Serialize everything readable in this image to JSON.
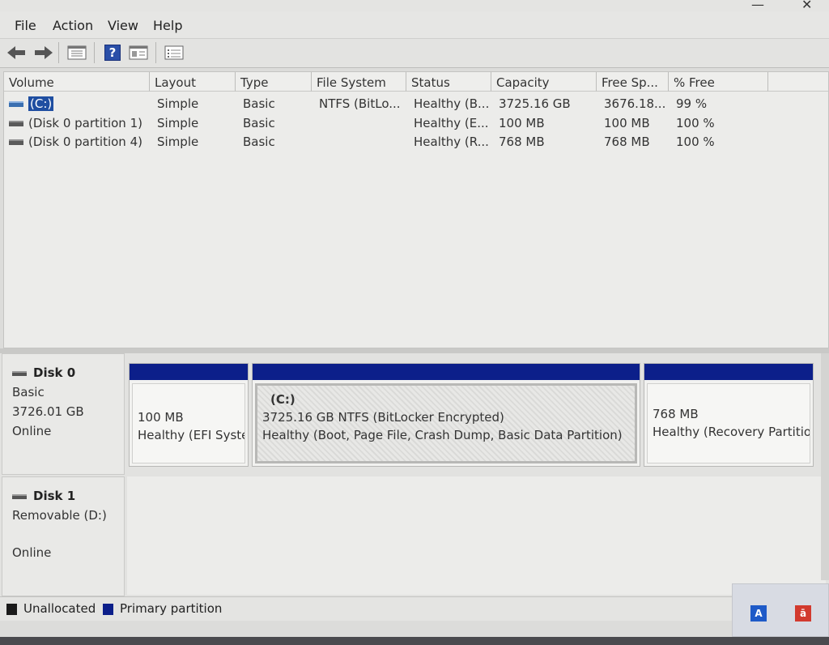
{
  "window": {
    "minimize_glyph": "—",
    "close_glyph": "✕"
  },
  "menu": {
    "items": [
      "File",
      "Action",
      "View",
      "Help"
    ]
  },
  "toolbar": {
    "buttons": [
      "back-icon",
      "forward-icon",
      "properties-grid-icon",
      "help-icon",
      "show-hide-pane-icon",
      "settings-list-icon"
    ],
    "help_glyph": "?"
  },
  "volume_table": {
    "columns": [
      "Volume",
      "Layout",
      "Type",
      "File System",
      "Status",
      "Capacity",
      "Free Sp...",
      "% Free"
    ],
    "rows": [
      {
        "volume": "(C:)",
        "layout": "Simple",
        "type": "Basic",
        "file_system": "NTFS (BitLo...",
        "status": "Healthy (B...",
        "capacity": "3725.16 GB",
        "free_space": "3676.18...",
        "percent_free": "99 %"
      },
      {
        "volume": "(Disk 0 partition 1)",
        "layout": "Simple",
        "type": "Basic",
        "file_system": "",
        "status": "Healthy (E...",
        "capacity": "100 MB",
        "free_space": "100 MB",
        "percent_free": "100 %"
      },
      {
        "volume": "(Disk 0 partition 4)",
        "layout": "Simple",
        "type": "Basic",
        "file_system": "",
        "status": "Healthy (R...",
        "capacity": "768 MB",
        "free_space": "768 MB",
        "percent_free": "100 %"
      }
    ]
  },
  "disks": [
    {
      "name": "Disk 0",
      "type": "Basic",
      "size": "3726.01 GB",
      "status": "Online",
      "partitions": [
        {
          "title": "",
          "line1": "100 MB",
          "line2": "Healthy (EFI Syste"
        },
        {
          "title": "(C:)",
          "line1": "3725.16 GB NTFS (BitLocker Encrypted)",
          "line2": "Healthy (Boot, Page File, Crash Dump, Basic Data Partition)"
        },
        {
          "title": "",
          "line1": "768 MB",
          "line2": "Healthy (Recovery Partitior"
        }
      ]
    },
    {
      "name": "Disk 1",
      "type": "Removable (D:)",
      "size": "",
      "status": "Online",
      "partitions": []
    }
  ],
  "legend": {
    "items": [
      {
        "label": "Unallocated",
        "color": "#1a1a1a"
      },
      {
        "label": "Primary partition",
        "color": "#0c1f8a"
      }
    ]
  },
  "tray": {
    "icons": [
      "A",
      "ā"
    ],
    "colors": {
      "accent_blue": "#1e5ac8",
      "accent_red": "#d23a2e"
    }
  }
}
